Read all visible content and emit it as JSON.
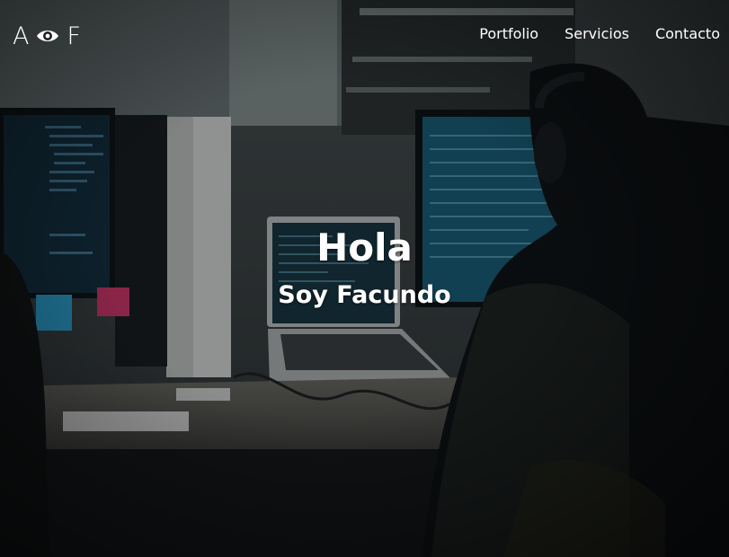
{
  "brand": {
    "left": "A",
    "right": "F",
    "icon": "eye-icon"
  },
  "nav": {
    "items": [
      {
        "label": "Portfolio"
      },
      {
        "label": "Servicios"
      },
      {
        "label": "Contacto"
      }
    ]
  },
  "hero": {
    "greeting": "Hola",
    "subtitle": "Soy Facundo",
    "background": "dark office photo with computer monitors, laptop and person with headphones"
  },
  "colors": {
    "text": "#ffffff",
    "overlay": "#0b0f12",
    "screen": "#1e6a8a"
  }
}
